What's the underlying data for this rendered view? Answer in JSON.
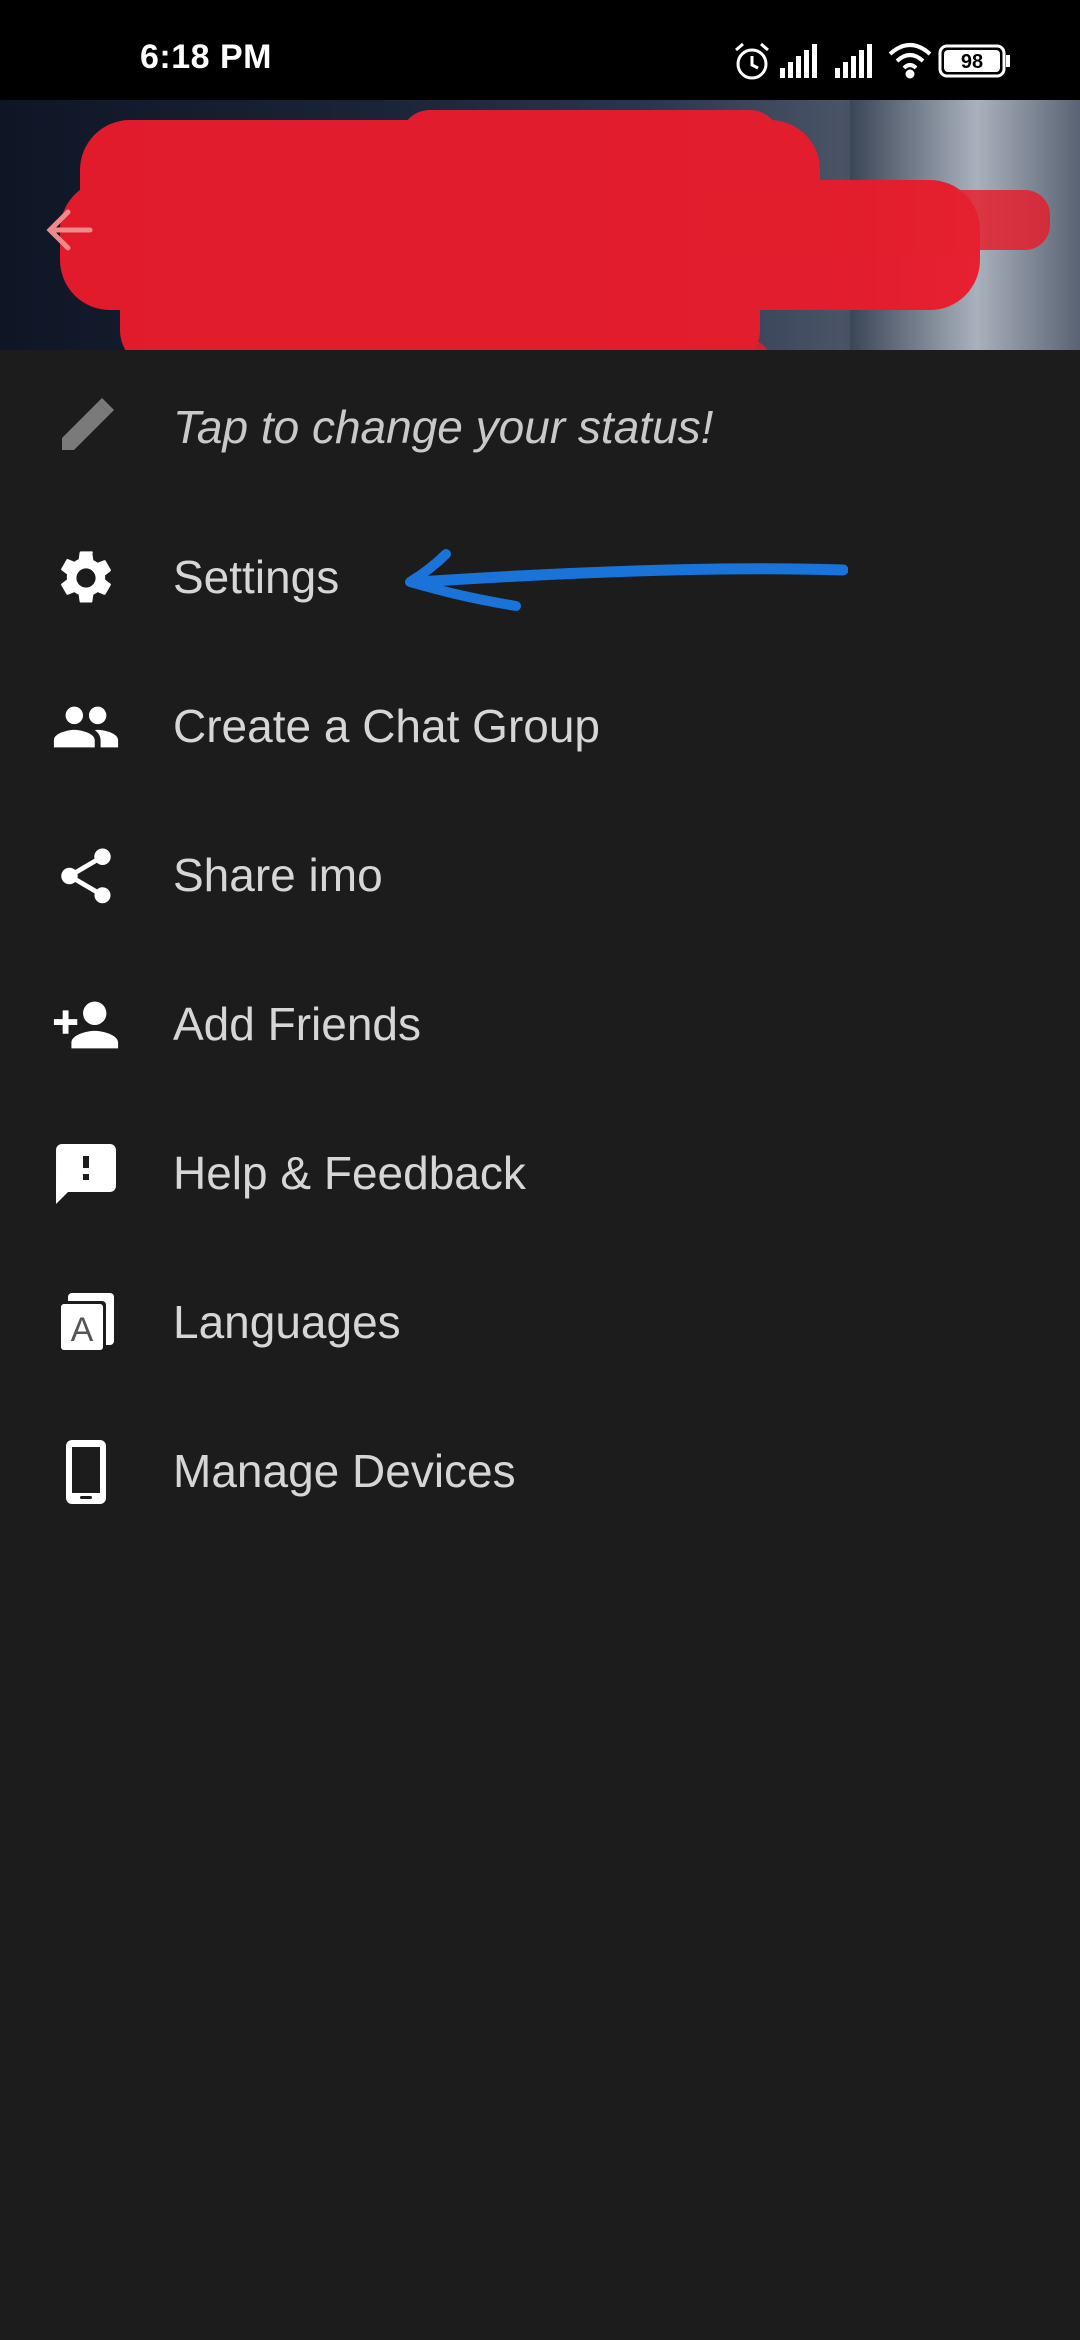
{
  "status_bar": {
    "time": "6:18 PM",
    "battery": "98",
    "icons": [
      "alarm-icon",
      "signal-icon",
      "signal-icon",
      "wifi-icon",
      "battery-icon"
    ]
  },
  "header": {
    "back_icon": "arrow-left-icon"
  },
  "status_prompt": {
    "text": "Tap to change your status!",
    "icon": "pencil-icon"
  },
  "menu": {
    "items": [
      {
        "label": "Settings",
        "icon": "gear-icon"
      },
      {
        "label": "Create a Chat Group",
        "icon": "group-icon"
      },
      {
        "label": "Share imo",
        "icon": "share-icon"
      },
      {
        "label": "Add Friends",
        "icon": "add-person-icon"
      },
      {
        "label": "Help & Feedback",
        "icon": "feedback-icon"
      },
      {
        "label": "Languages",
        "icon": "language-icon"
      },
      {
        "label": "Manage Devices",
        "icon": "phone-icon"
      }
    ]
  },
  "colors": {
    "background": "#1c1c1c",
    "text": "#d6d6d6",
    "accent_back": "#f08a8a",
    "annotation": "#1a73d9",
    "redaction": "#e81c2c"
  }
}
